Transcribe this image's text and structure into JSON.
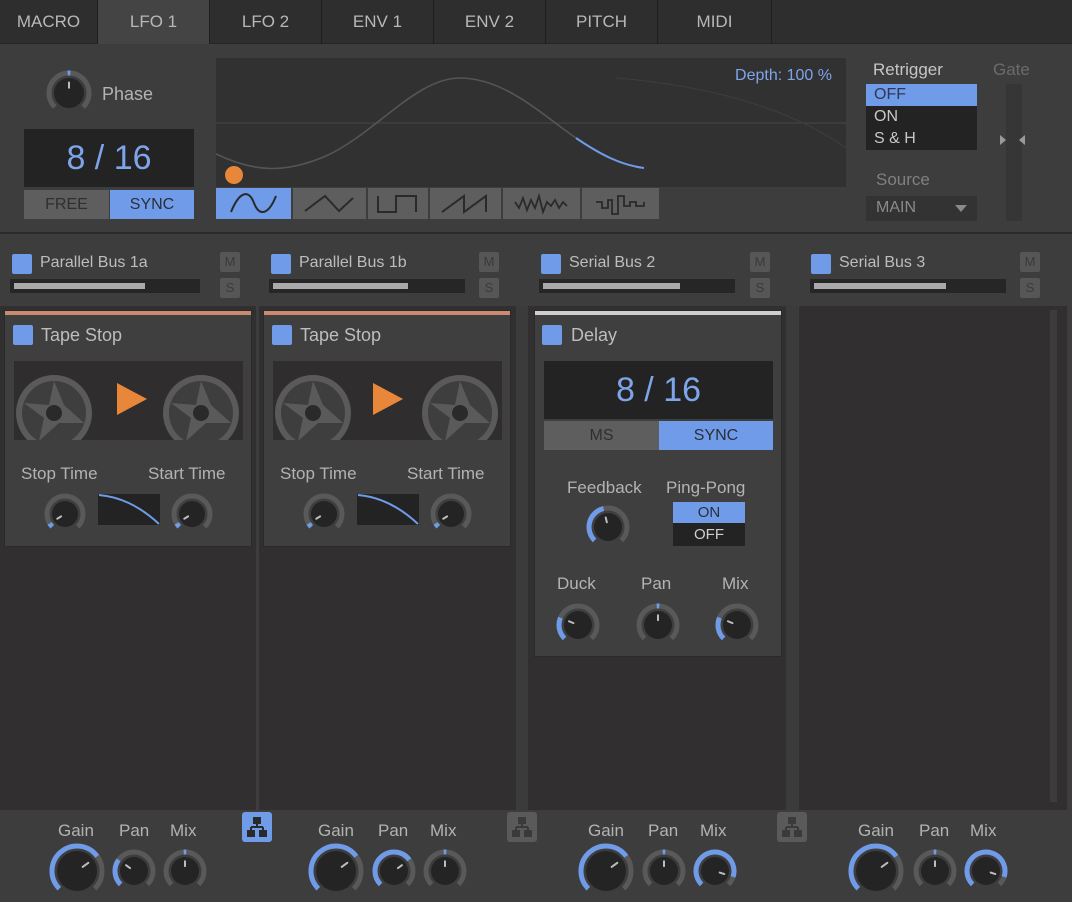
{
  "tabs": [
    {
      "label": "MACRO",
      "active": false
    },
    {
      "label": "LFO 1",
      "active": true
    },
    {
      "label": "LFO 2",
      "active": false
    },
    {
      "label": "ENV 1",
      "active": false
    },
    {
      "label": "ENV 2",
      "active": false
    },
    {
      "label": "PITCH",
      "active": false
    },
    {
      "label": "MIDI",
      "active": false
    }
  ],
  "lfo": {
    "phase_label": "Phase",
    "phase_value": 0.5,
    "rate_display": "8 / 16",
    "mode_buttons": [
      {
        "label": "FREE",
        "active": false
      },
      {
        "label": "SYNC",
        "active": true
      }
    ],
    "depth_label": "Depth: 100 %",
    "shapes": [
      {
        "name": "sine",
        "active": true
      },
      {
        "name": "triangle",
        "active": false
      },
      {
        "name": "square",
        "active": false
      },
      {
        "name": "saw",
        "active": false
      },
      {
        "name": "noise",
        "active": false
      },
      {
        "name": "sample-hold",
        "active": false
      }
    ],
    "retrigger_label": "Retrigger",
    "retrigger_options": [
      {
        "label": "OFF",
        "selected": true
      },
      {
        "label": "ON",
        "selected": false
      },
      {
        "label": "S & H",
        "selected": false
      }
    ],
    "gate_label": "Gate",
    "source_label": "Source",
    "source_value": "MAIN"
  },
  "colors": {
    "accent": "#6f9be8",
    "orange": "#e8863a",
    "tape_accent": "#c98a70",
    "delay_accent": "#cfcfcf"
  },
  "buses": [
    {
      "name": "Parallel Bus 1a",
      "level": 0.72,
      "mute": "M",
      "solo": "S"
    },
    {
      "name": "Parallel Bus 1b",
      "level": 0.72,
      "mute": "M",
      "solo": "S"
    },
    {
      "name": "Serial Bus 2",
      "level": 0.73,
      "mute": "M",
      "solo": "S"
    },
    {
      "name": "Serial Bus 3",
      "level": 0.7,
      "mute": "M",
      "solo": "S"
    }
  ],
  "tape_stops": [
    {
      "title": "Tape Stop",
      "stop_label": "Stop Time",
      "start_label": "Start Time",
      "stop_value": 0.05,
      "start_value": 0.05
    },
    {
      "title": "Tape Stop",
      "stop_label": "Stop Time",
      "start_label": "Start Time",
      "stop_value": 0.05,
      "start_value": 0.05
    }
  ],
  "delay": {
    "title": "Delay",
    "time_display": "8 / 16",
    "mode_buttons": [
      {
        "label": "MS",
        "active": false
      },
      {
        "label": "SYNC",
        "active": true
      }
    ],
    "feedback_label": "Feedback",
    "feedback_value": 0.45,
    "pingpong_label": "Ping-Pong",
    "pingpong_options": [
      {
        "label": "ON",
        "selected": true
      },
      {
        "label": "OFF",
        "selected": false
      }
    ],
    "duck_label": "Duck",
    "duck_value": 0.25,
    "pan_label": "Pan",
    "pan_value": 0.5,
    "mix_label": "Mix",
    "mix_value": 0.25
  },
  "bus_controls": [
    {
      "gain_label": "Gain",
      "pan_label": "Pan",
      "mix_label": "Mix",
      "gain": 0.7,
      "pan": 0.3,
      "mix": 0.5,
      "route_active": true
    },
    {
      "gain_label": "Gain",
      "pan_label": "Pan",
      "mix_label": "Mix",
      "gain": 0.7,
      "pan": 0.7,
      "mix": 0.5,
      "route_active": false
    },
    {
      "gain_label": "Gain",
      "pan_label": "Pan",
      "mix_label": "Mix",
      "gain": 0.7,
      "pan": 0.5,
      "mix": 0.9,
      "route_active": false
    },
    {
      "gain_label": "Gain",
      "pan_label": "Pan",
      "mix_label": "Mix",
      "gain": 0.7,
      "pan": 0.5,
      "mix": 0.9
    }
  ]
}
